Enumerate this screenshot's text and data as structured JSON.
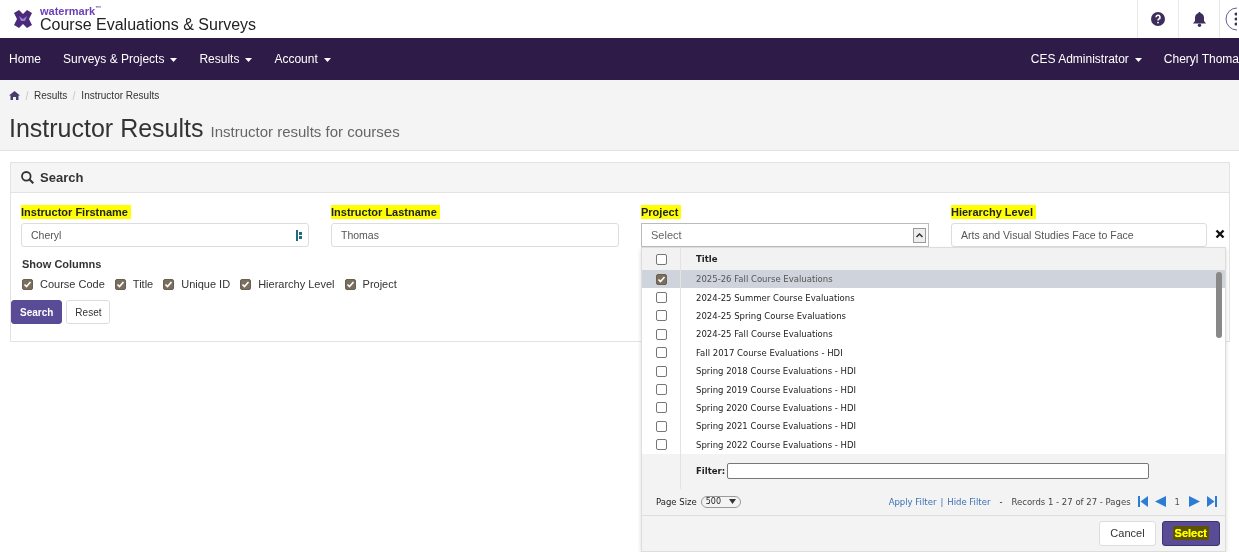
{
  "header": {
    "brand_small": "watermark",
    "brand_mark": "™",
    "brand_title": "Course Evaluations & Surveys"
  },
  "nav": {
    "left": [
      {
        "label": "Home",
        "dropdown": false
      },
      {
        "label": "Surveys & Projects",
        "dropdown": true
      },
      {
        "label": "Results",
        "dropdown": true
      },
      {
        "label": "Account",
        "dropdown": true
      }
    ],
    "right": [
      {
        "label": "CES Administrator",
        "dropdown": true
      },
      {
        "label": "Cheryl Thoma",
        "dropdown": false
      }
    ]
  },
  "breadcrumb": [
    "Results",
    "Instructor Results"
  ],
  "page_title": "Instructor Results",
  "page_subtitle": "Instructor results for courses",
  "search_panel": {
    "title": "Search",
    "fields": [
      {
        "label": "Instructor Firstname",
        "highlighted": true,
        "kind": "autofill",
        "value": "Cheryl"
      },
      {
        "label": "Instructor Lastname",
        "highlighted": true,
        "kind": "text",
        "value": "Thomas"
      },
      {
        "label": "Project",
        "highlighted": true,
        "kind": "select",
        "placeholder": "Select"
      },
      {
        "label": "Hierarchy Level",
        "highlighted": true,
        "kind": "clearable",
        "value": "Arts and Visual Studies Face to Face"
      }
    ],
    "show_columns": {
      "label": "Show Columns",
      "options": [
        {
          "label": "Course Code",
          "checked": true
        },
        {
          "label": "Title",
          "checked": true
        },
        {
          "label": "Unique ID",
          "checked": true
        },
        {
          "label": "Hierarchy Level",
          "checked": true
        },
        {
          "label": "Project",
          "checked": true
        }
      ]
    },
    "buttons": [
      {
        "label": "Search",
        "kind": "primary"
      },
      {
        "label": "Reset",
        "kind": "default"
      }
    ]
  },
  "project_dropdown": {
    "all_checked": false,
    "column": "Title",
    "rows": [
      {
        "title": "2025-26 Fall Course Evaluations",
        "checked": true,
        "selected": true
      },
      {
        "title": "2024-25 Summer Course Evaluations",
        "checked": false,
        "selected": false
      },
      {
        "title": "2024-25 Spring Course Evaluations",
        "checked": false,
        "selected": false
      },
      {
        "title": "2024-25 Fall Course Evaluations",
        "checked": false,
        "selected": false
      },
      {
        "title": "Fall 2017 Course Evaluations - HDI",
        "checked": false,
        "selected": false
      },
      {
        "title": "Spring 2018 Course Evaluations - HDI",
        "checked": false,
        "selected": false
      },
      {
        "title": "Spring 2019 Course Evaluations - HDI",
        "checked": false,
        "selected": false
      },
      {
        "title": "Spring 2020 Course Evaluations - HDI",
        "checked": false,
        "selected": false
      },
      {
        "title": "Spring 2021 Course Evaluations - HDI",
        "checked": false,
        "selected": false
      },
      {
        "title": "Spring 2022 Course Evaluations - HDI",
        "checked": false,
        "selected": false
      }
    ],
    "filter_label": "Filter:",
    "page_size_label": "Page Size",
    "page_size": "500",
    "links": [
      "Apply Filter",
      "Hide Filter"
    ],
    "link_separator": "|",
    "dash": "-",
    "records": "Records 1 - 27 of 27 - Pages",
    "page": "1",
    "buttons": [
      {
        "label": "Cancel",
        "kind": "default",
        "highlighted": false
      },
      {
        "label": "Select",
        "kind": "primary",
        "highlighted": true
      }
    ]
  }
}
